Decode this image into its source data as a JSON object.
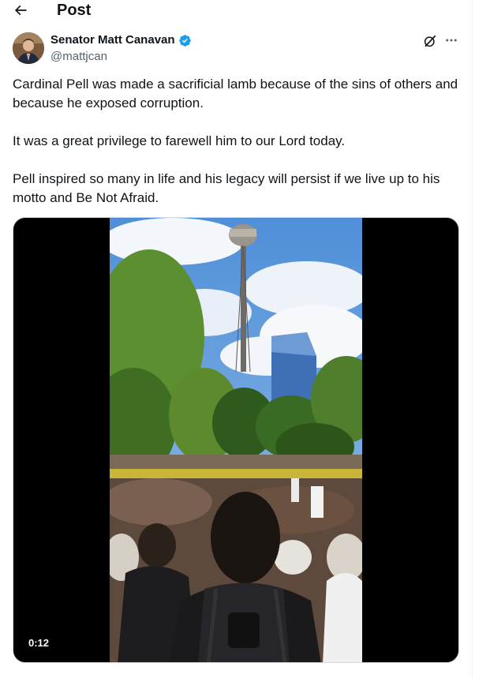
{
  "header": {
    "title": "Post",
    "back_icon": "arrow-left-icon"
  },
  "author": {
    "name": "Senator Matt Canavan",
    "handle": "@mattjcan",
    "verified_icon": "verified-badge-icon",
    "verified_color": "#1d9bf0"
  },
  "actions": {
    "grok_icon": "grok-icon",
    "more_icon": "more-horizontal-icon"
  },
  "post": {
    "paragraphs": [
      "Cardinal Pell was made a sacrificial lamb because of the sins of others and because he exposed corruption.",
      "It was a great privilege to farewell him to our Lord today.",
      "Pell inspired so many in life and his legacy will persist if we live up to his motto and Be Not Afraid."
    ]
  },
  "media": {
    "type": "video",
    "duration": "0:12"
  },
  "colors": {
    "text_primary": "#0f1419",
    "text_secondary": "#536471",
    "accent": "#1d9bf0",
    "border": "#eff3f4"
  }
}
